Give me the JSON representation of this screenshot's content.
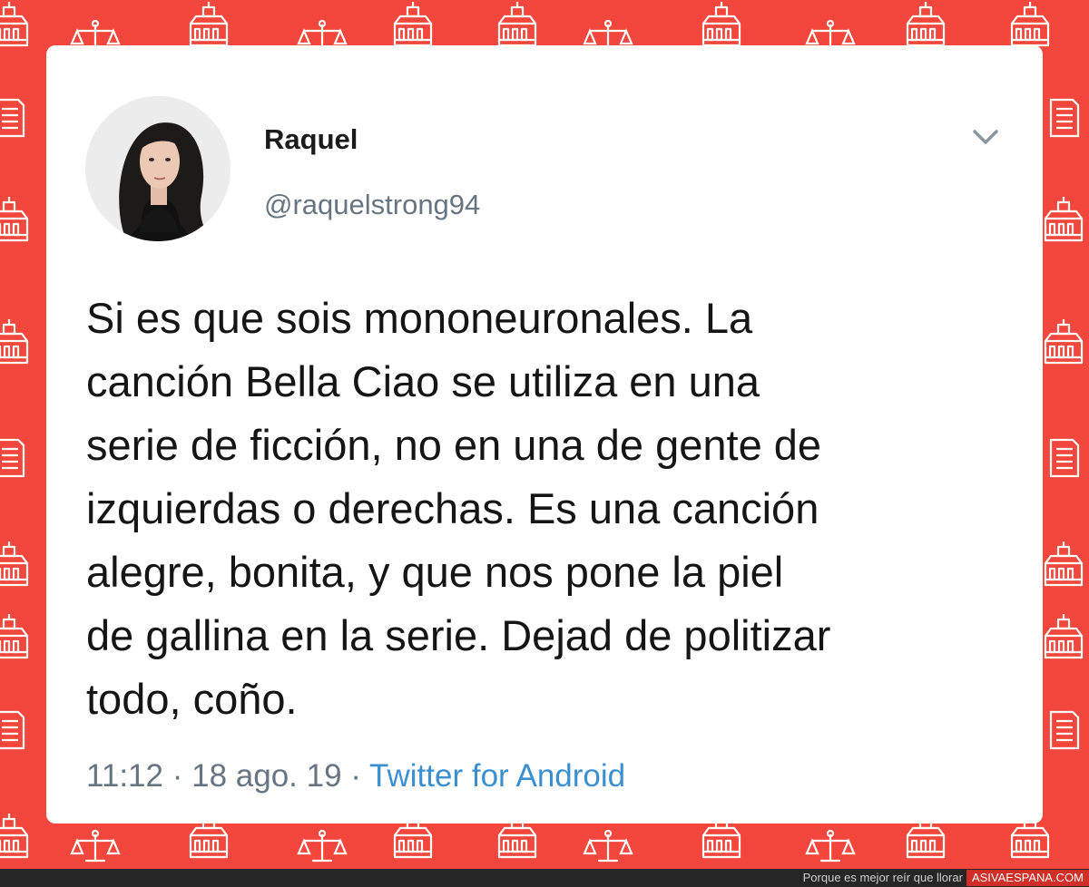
{
  "tweet": {
    "display_name": "Raquel",
    "username": "@raquelstrong94",
    "text": "Si es que sois mononeuronales. La\ncanción Bella Ciao se utiliza en una\nserie de ficción, no en una de gente de\nizquierdas o derechas. Es una canción\nalegre, bonita, y que nos pone la piel\nde gallina en la serie. Dejad de politizar\ntodo, coño.",
    "time": "11:12",
    "date": "18 ago. 19",
    "separator": "·",
    "source": "Twitter for Android",
    "menu_icon": "chevron-down-icon"
  },
  "footer": {
    "slogan": "Porque es mejor reír que llorar",
    "site": "ASIVAESPANA.COM"
  },
  "colors": {
    "background": "#f3473d",
    "card": "#ffffff",
    "link": "#3a8fd0",
    "muted": "#667581"
  }
}
